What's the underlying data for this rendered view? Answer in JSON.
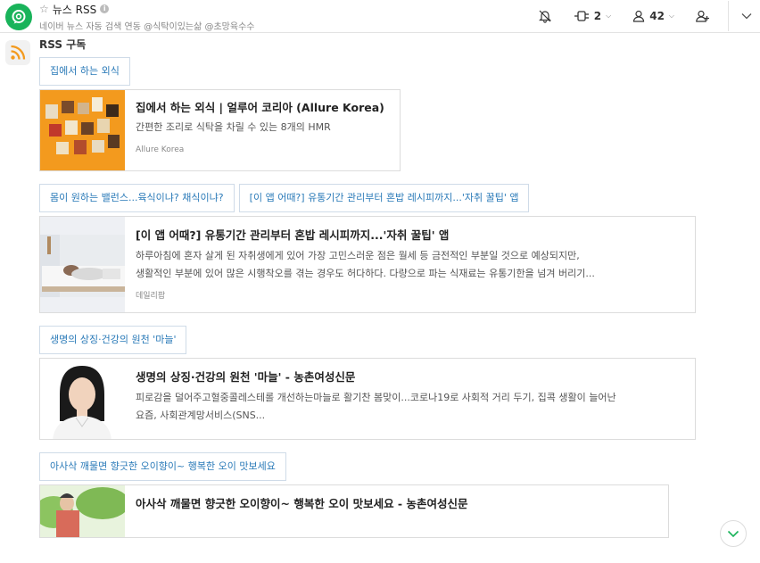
{
  "header": {
    "star": "☆",
    "channel_title": "뉴스 RSS",
    "info": "i",
    "subtitle": "네이버 뉴스 자동 검색 연동 @식탁이있는삶 @초망육수수",
    "integrations_count": "2",
    "members_count": "42"
  },
  "section": {
    "title": "RSS 구독"
  },
  "feed": [
    {
      "link": "집에서 하는 외식",
      "title": "집에서 하는 외식 | 얼루어 코리아 (Allure Korea)",
      "desc1": "간편한 조리로 식탁을 차릴 수 있는 8개의 HMR",
      "desc2": "",
      "source": "Allure Korea"
    },
    {
      "link": "몸이 원하는 밸런스...육식이냐? 채식이냐?"
    },
    {
      "link": "[이 앱 어때?] 유통기간 관리부터 혼밥 레시피까지...'자취 꿀팁' 앱",
      "title": "[이 앱 어때?] 유통기간 관리부터 혼밥 레시피까지...'자취 꿀팁' 앱",
      "desc1": "하루아침에 혼자 살게 된 자취생에게 있어 가장 고민스러운 점은 월세 등 금전적인 부분일 것으로 예상되지만,",
      "desc2": "생활적인 부분에 있어 많은 시행착오를 겪는 경우도 허다하다. 다량으로 파는 식재료는 유통기한을 넘겨 버리기...",
      "source": "데일리팝"
    },
    {
      "link": "생명의 상징·건강의 원천 '마늘'",
      "title": "생명의 상징·건강의 원천 '마늘' - 농촌여성신문",
      "desc1": "피로감을 덜어주고혈중콜레스테롤 개선하는마늘로 활기찬 봄맞이...코로나19로 사회적 거리 두기, 집콕 생활이 늘어난",
      "desc2": "요즘, 사회관계망서비스(SNS...",
      "source": ""
    },
    {
      "link": "아사삭 깨물면 향긋한 오이향이~ 행복한 오이 맛보세요",
      "title": "아사삭 깨물면 향긋한 오이향이~ 행복한 오이 맛보세요 - 농촌여성신문"
    }
  ],
  "colors": {
    "brand": "#19b35a",
    "link": "#2a7ab8",
    "rss": "#f39a1e",
    "scroll": "#19b35a"
  },
  "icons": {
    "logo": "chat-bubble-logo",
    "rss": "rss-feed-icon",
    "bell": "bell-off-icon",
    "plug": "plug-icon",
    "person": "person-icon",
    "add_person": "add-person-icon",
    "collapse": "chevron-down-icon",
    "scroll": "scroll-down-icon"
  }
}
